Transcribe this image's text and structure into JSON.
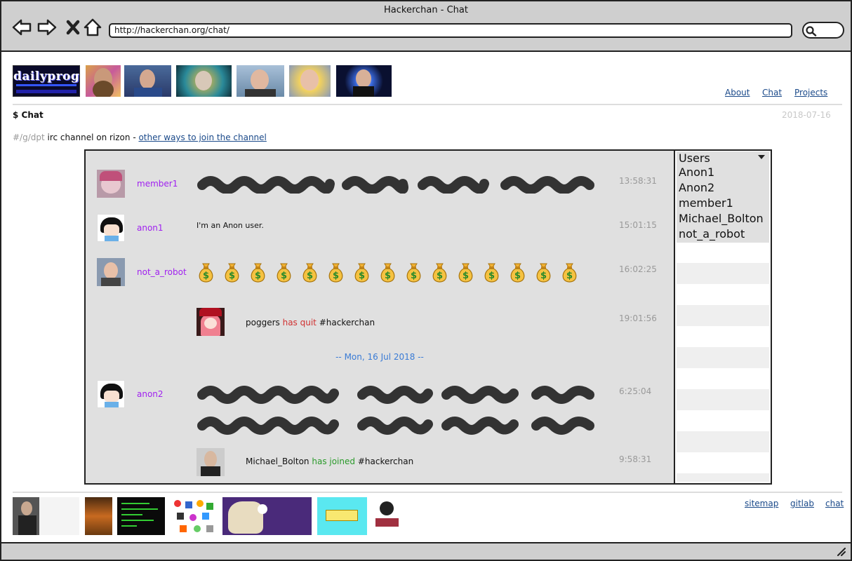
{
  "window": {
    "title": "Hackerchan - Chat"
  },
  "browser": {
    "url": "http://hackerchan.org/chat/",
    "buttons": [
      "back-icon",
      "forward-icon",
      "close-icon",
      "home-icon"
    ]
  },
  "header": {
    "logo_text": "dailyprog",
    "nav": [
      {
        "label": "About"
      },
      {
        "label": "Chat"
      },
      {
        "label": "Projects"
      }
    ]
  },
  "page": {
    "heading": "$ Chat",
    "date": "2018-07-16",
    "channel_name": "#/g/dpt",
    "channel_text": " irc channel on rizon - ",
    "channel_link": "other ways to join the channel"
  },
  "chat": {
    "messages": [
      {
        "nick": "member1",
        "time": "13:58:31",
        "kind": "scribbled"
      },
      {
        "nick": "anon1",
        "time": "15:01:15",
        "text": "I'm an Anon user."
      },
      {
        "nick": "not_a_robot",
        "time": "16:02:25",
        "kind": "money-bags",
        "count": 15
      },
      {
        "event": {
          "user": "poggers",
          "action": "has quit",
          "channel": "#hackerchan"
        },
        "time": "19:01:56"
      },
      {
        "nick": "anon2",
        "time": "6:25:04",
        "kind": "scribbled"
      },
      {
        "event": {
          "user": "Michael_Bolton",
          "action": "has joined",
          "channel": "#hackerchan"
        },
        "time": "9:58:31"
      }
    ],
    "date_divider": "-- Mon, 16 Jul 2018 --",
    "colors": {
      "nick": "#a020f0",
      "quit": "#d03030",
      "joined": "#2a9a2a",
      "divider": "#3a7bd5"
    }
  },
  "users": {
    "header": "Users",
    "list": [
      "Anon1",
      "Anon2",
      "member1",
      "Michael_Bolton",
      "not_a_robot"
    ]
  },
  "footer": {
    "links": [
      {
        "label": "sitemap"
      },
      {
        "label": "gitlab"
      },
      {
        "label": "chat"
      }
    ]
  }
}
